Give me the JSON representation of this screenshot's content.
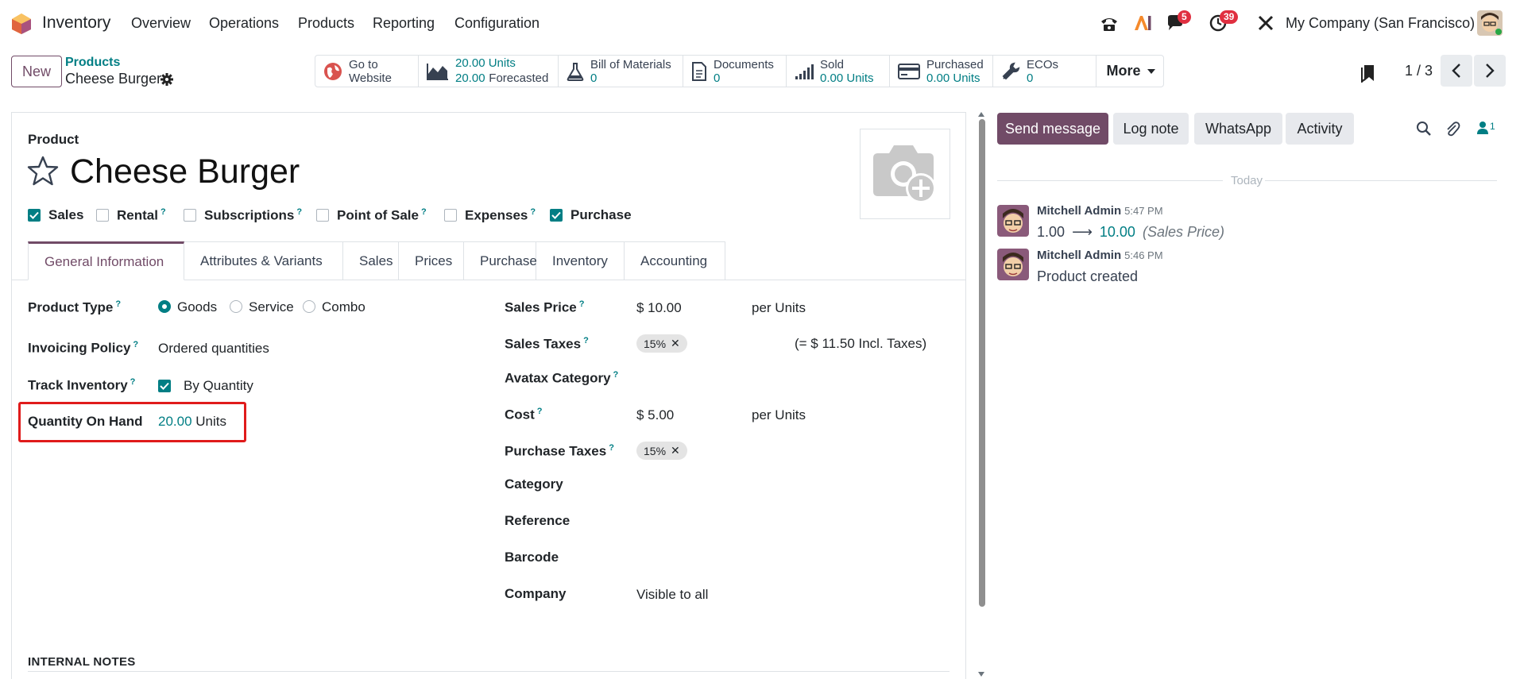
{
  "nav": {
    "app_name": "Inventory",
    "menu": [
      "Overview",
      "Operations",
      "Products",
      "Reporting",
      "Configuration"
    ],
    "messages_badge": "5",
    "activities_badge": "39",
    "company": "My Company (San Francisco)"
  },
  "control": {
    "new_label": "New",
    "breadcrumb_parent": "Products",
    "breadcrumb_current": "Cheese Burger",
    "pager": "1 / 3",
    "more_label": "More"
  },
  "stats": {
    "website": {
      "line1": "Go to",
      "line2": "Website"
    },
    "onhand": {
      "line1": "20.00 Units",
      "line2_value": "20.00",
      "line2_label": "Forecasted"
    },
    "bom": {
      "label": "Bill of Materials",
      "value": "0"
    },
    "documents": {
      "label": "Documents",
      "value": "0"
    },
    "sold": {
      "label": "Sold",
      "value": "0.00 Units"
    },
    "purchased": {
      "label": "Purchased",
      "value": "0.00 Units"
    },
    "ecos": {
      "label": "ECOs",
      "value": "0"
    }
  },
  "product": {
    "section_label": "Product",
    "name": "Cheese Burger",
    "flags": [
      {
        "label": "Sales",
        "checked": true,
        "help": false
      },
      {
        "label": "Rental",
        "checked": false,
        "help": true
      },
      {
        "label": "Subscriptions",
        "checked": false,
        "help": true
      },
      {
        "label": "Point of Sale",
        "checked": false,
        "help": true
      },
      {
        "label": "Expenses",
        "checked": false,
        "help": true
      },
      {
        "label": "Purchase",
        "checked": true,
        "help": false
      }
    ]
  },
  "tabs": [
    "General Information",
    "Attributes & Variants",
    "Sales",
    "Prices",
    "Purchase",
    "Inventory",
    "Accounting"
  ],
  "left_fields": {
    "product_type_label": "Product Type",
    "product_type_options": [
      "Goods",
      "Service",
      "Combo"
    ],
    "product_type_selected": "Goods",
    "invoicing_policy_label": "Invoicing Policy",
    "invoicing_policy_value": "Ordered quantities",
    "track_inventory_label": "Track Inventory",
    "track_inventory_value": "By Quantity",
    "qty_label": "Quantity On Hand",
    "qty_value": "20.00",
    "qty_unit": "Units"
  },
  "right_fields": {
    "sales_price_label": "Sales Price",
    "sales_price_value": "$ 10.00",
    "sales_price_unit": "per Units",
    "sales_taxes_label": "Sales Taxes",
    "sales_taxes_tag": "15%",
    "sales_taxes_incl": "(= $ 11.50 Incl. Taxes)",
    "avatax_label": "Avatax Category",
    "cost_label": "Cost",
    "cost_value": "$ 5.00",
    "cost_unit": "per Units",
    "purchase_taxes_label": "Purchase Taxes",
    "purchase_taxes_tag": "15%",
    "category_label": "Category",
    "reference_label": "Reference",
    "barcode_label": "Barcode",
    "company_label": "Company",
    "company_placeholder": "Visible to all"
  },
  "notes_label": "INTERNAL NOTES",
  "chatter": {
    "send_message": "Send message",
    "log_note": "Log note",
    "whatsapp": "WhatsApp",
    "activity": "Activity",
    "followers_count": "1",
    "today": "Today",
    "messages": [
      {
        "author": "Mitchell Admin",
        "time": "5:47 PM",
        "old": "1.00",
        "new": "10.00",
        "field": "(Sales Price)"
      },
      {
        "author": "Mitchell Admin",
        "time": "5:46 PM",
        "body": "Product created"
      }
    ]
  },
  "colors": {
    "brand": "#714b67",
    "accent": "#017e84",
    "badge": "#e02f40",
    "highlight": "#e01b1b"
  }
}
